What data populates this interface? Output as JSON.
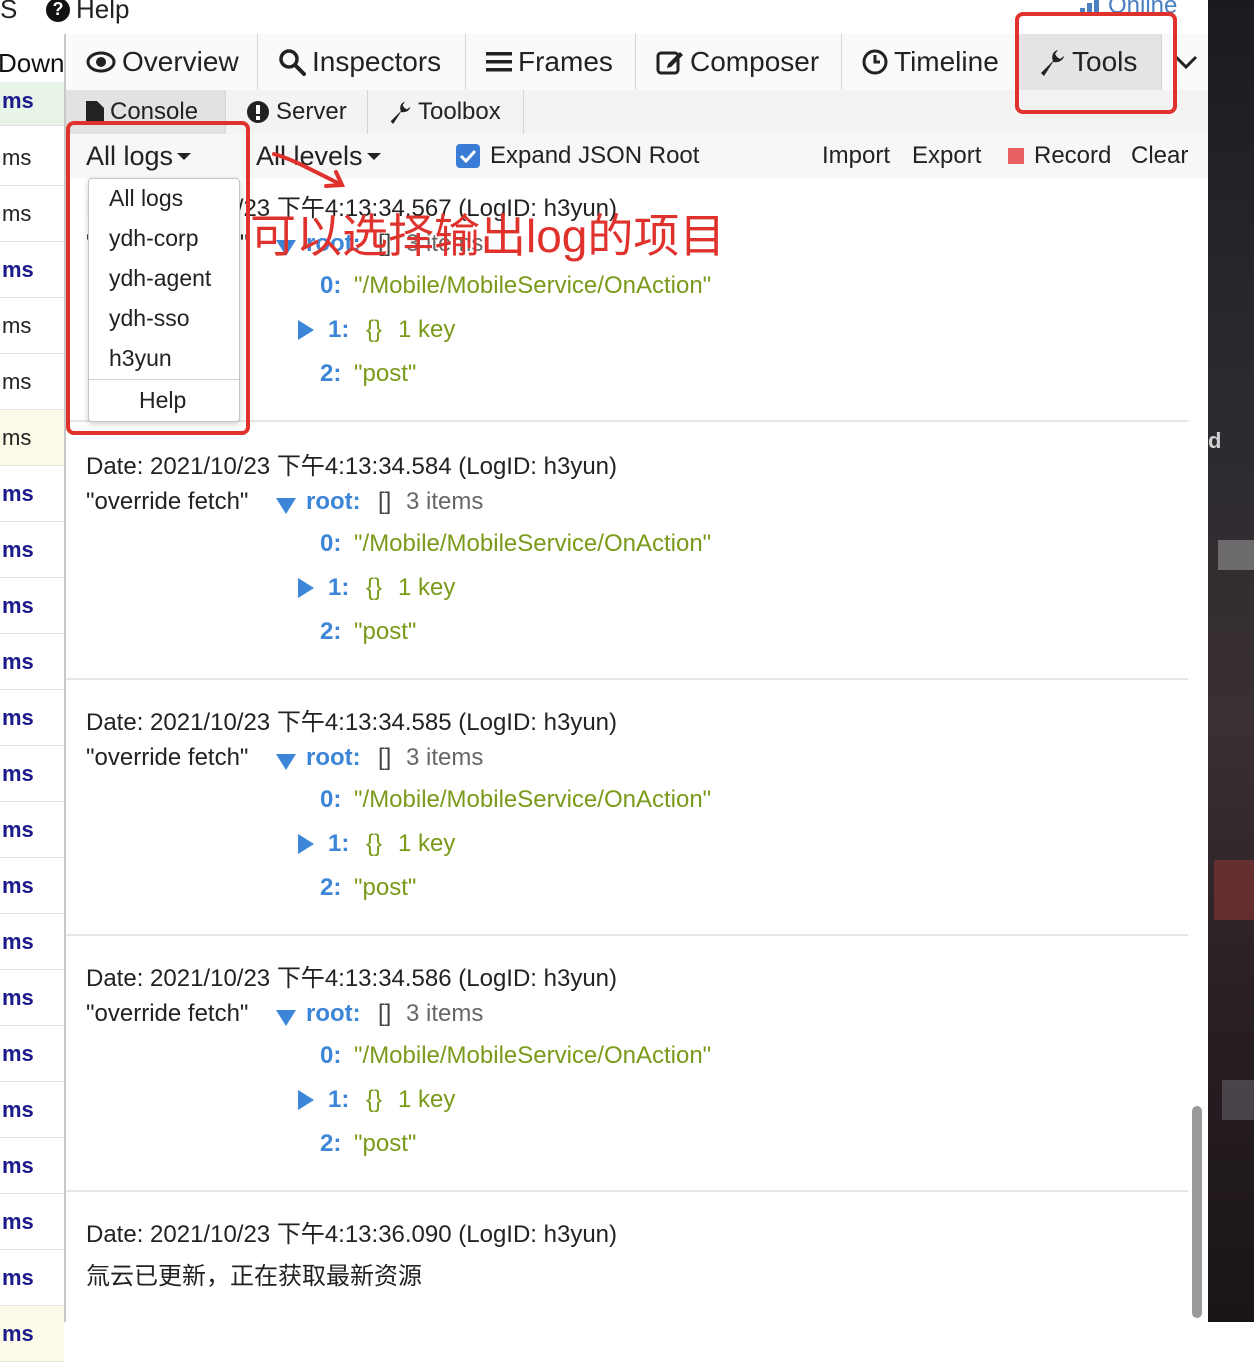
{
  "menubar": {
    "item_s": "S",
    "help_label": "Help",
    "help_icon": "?",
    "online_label": "Online"
  },
  "left_panel": {
    "header": "Down",
    "rows": [
      {
        "text": "ms",
        "style": "bold"
      },
      {
        "text": "ms",
        "style": "plain"
      },
      {
        "text": "ms",
        "style": "plain"
      },
      {
        "text": "ms",
        "style": "bold"
      },
      {
        "text": "ms",
        "style": "plain"
      },
      {
        "text": "ms",
        "style": "plain"
      },
      {
        "text": "ms",
        "style": "plain"
      },
      {
        "text": "ms",
        "style": "bold"
      },
      {
        "text": "ms",
        "style": "bold"
      },
      {
        "text": "ms",
        "style": "bold"
      },
      {
        "text": "ms",
        "style": "bold"
      },
      {
        "text": "ms",
        "style": "bold"
      },
      {
        "text": "ms",
        "style": "bold"
      },
      {
        "text": "ms",
        "style": "bold"
      },
      {
        "text": "ms",
        "style": "bold"
      },
      {
        "text": "ms",
        "style": "bold"
      },
      {
        "text": "ms",
        "style": "bold"
      },
      {
        "text": "ms",
        "style": "bold"
      },
      {
        "text": "ms",
        "style": "bold"
      },
      {
        "text": "ms",
        "style": "bold"
      },
      {
        "text": "ms",
        "style": "bold"
      },
      {
        "text": "ms",
        "style": "bold"
      },
      {
        "text": "ms",
        "style": "bold"
      }
    ]
  },
  "tabs": [
    {
      "label": "Overview",
      "icon": "eye-icon"
    },
    {
      "label": "Inspectors",
      "icon": "search-icon"
    },
    {
      "label": "Frames",
      "icon": "list-icon"
    },
    {
      "label": "Composer",
      "icon": "edit-icon"
    },
    {
      "label": "Timeline",
      "icon": "clock-icon"
    },
    {
      "label": "Tools",
      "icon": "wrench-icon",
      "active": true
    }
  ],
  "subtabs": [
    {
      "label": "Console",
      "icon": "file-icon",
      "active": true
    },
    {
      "label": "Server",
      "icon": "alert-icon"
    },
    {
      "label": "Toolbox",
      "icon": "wrench-icon"
    }
  ],
  "toolbar": {
    "logs_filter": "All logs",
    "levels_filter": "All levels",
    "expand_json_label": "Expand JSON Root",
    "expand_json_checked": true,
    "import_label": "Import",
    "export_label": "Export",
    "record_label": "Record",
    "clear_label": "Clear"
  },
  "dropdown": {
    "items": [
      "All logs",
      "ydh-corp",
      "ydh-agent",
      "ydh-sso",
      "h3yun"
    ],
    "help_label": "Help"
  },
  "log_entries": [
    {
      "date": "Date: 2021/10/23 下午4:13:34.567 (LogID: h3yun)",
      "tag": "\"override fetch\"",
      "root_label": "root:",
      "root_bracket": "[]",
      "root_meta": "3 items",
      "item0_key": "0:",
      "item0_val": "\"/Mobile/MobileService/OnAction\"",
      "item1_key": "1:",
      "item1_bracket": "{}",
      "item1_meta": "1 key",
      "item2_key": "2:",
      "item2_val": "\"post\""
    },
    {
      "date": "Date: 2021/10/23 下午4:13:34.584 (LogID: h3yun)",
      "tag": "\"override fetch\"",
      "root_label": "root:",
      "root_bracket": "[]",
      "root_meta": "3 items",
      "item0_key": "0:",
      "item0_val": "\"/Mobile/MobileService/OnAction\"",
      "item1_key": "1:",
      "item1_bracket": "{}",
      "item1_meta": "1 key",
      "item2_key": "2:",
      "item2_val": "\"post\""
    },
    {
      "date": "Date: 2021/10/23 下午4:13:34.585 (LogID: h3yun)",
      "tag": "\"override fetch\"",
      "root_label": "root:",
      "root_bracket": "[]",
      "root_meta": "3 items",
      "item0_key": "0:",
      "item0_val": "\"/Mobile/MobileService/OnAction\"",
      "item1_key": "1:",
      "item1_bracket": "{}",
      "item1_meta": "1 key",
      "item2_key": "2:",
      "item2_val": "\"post\""
    },
    {
      "date": "Date: 2021/10/23 下午4:13:34.586 (LogID: h3yun)",
      "tag": "\"override fetch\"",
      "root_label": "root:",
      "root_bracket": "[]",
      "root_meta": "3 items",
      "item0_key": "0:",
      "item0_val": "\"/Mobile/MobileService/OnAction\"",
      "item1_key": "1:",
      "item1_bracket": "{}",
      "item1_meta": "1 key",
      "item2_key": "2:",
      "item2_val": "\"post\""
    }
  ],
  "last_entry": {
    "date": "Date: 2021/10/23 下午4:13:36.090 (LogID: h3yun)",
    "message": "氚云已更新，正在获取最新资源"
  },
  "annotation": {
    "text": "可以选择输出log的项目",
    "color": "#e0322d"
  },
  "outside_letter": "d",
  "colors": {
    "accent_blue": "#3d85d6",
    "string_green": "#7a9a1a",
    "record_red": "#e86060",
    "checkbox_blue": "#3a7bd5"
  }
}
